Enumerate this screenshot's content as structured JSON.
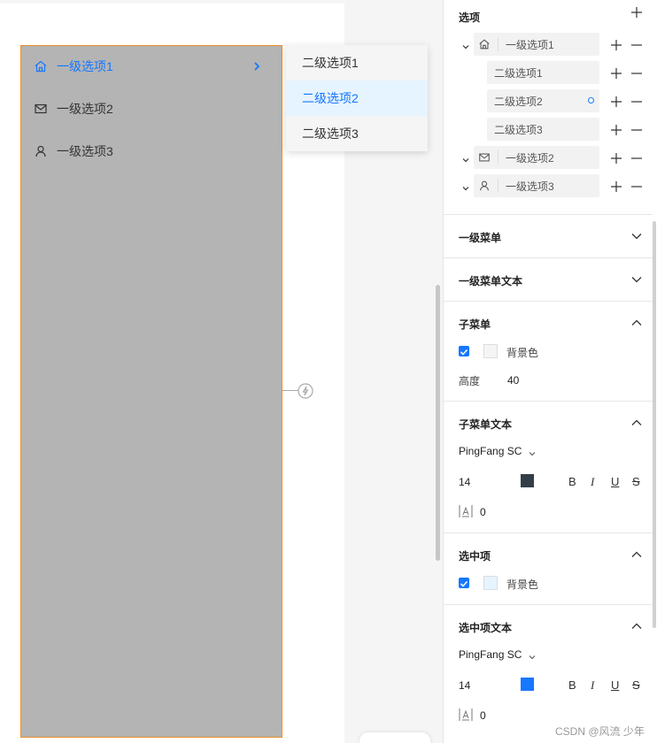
{
  "canvas": {
    "menu": {
      "items": [
        {
          "label": "一级选项1",
          "icon": "home-icon",
          "active": true
        },
        {
          "label": "一级选项2",
          "icon": "mail-icon",
          "active": false
        },
        {
          "label": "一级选项3",
          "icon": "user-icon",
          "active": false
        }
      ]
    },
    "submenu": {
      "items": [
        {
          "label": "二级选项1",
          "selected": false
        },
        {
          "label": "二级选项2",
          "selected": true
        },
        {
          "label": "二级选项3",
          "selected": false
        }
      ]
    }
  },
  "panel": {
    "options": {
      "title": "选项",
      "tree": [
        {
          "label": "一级选项1",
          "icon": "home-icon",
          "level": 1
        },
        {
          "label": "二级选项1",
          "level": 2
        },
        {
          "label": "二级选项2",
          "level": 2,
          "marked": true
        },
        {
          "label": "二级选项3",
          "level": 2
        },
        {
          "label": "一级选项2",
          "icon": "mail-icon",
          "level": 1
        },
        {
          "label": "一级选项3",
          "icon": "user-icon",
          "level": 1
        }
      ]
    },
    "sections": {
      "level1_menu": "一级菜单",
      "level1_text": "一级菜单文本",
      "submenu": "子菜单",
      "submenu_text": "子菜单文本",
      "selected": "选中项",
      "selected_text": "选中项文本"
    },
    "submenu": {
      "bg_label": "背景色",
      "bg_color": "#f5f5f5",
      "height_label": "高度",
      "height_value": "40"
    },
    "submenu_text": {
      "font": "PingFang SC",
      "size": "14",
      "color": "#333f48",
      "spacing": "0"
    },
    "selected": {
      "bg_label": "背景色",
      "bg_color": "#e6f4ff"
    },
    "selected_text": {
      "font": "PingFang SC",
      "size": "14",
      "color": "#1677ff",
      "spacing": "0"
    },
    "format": {
      "bold": "B",
      "italic": "I",
      "underline": "U",
      "strike": "S"
    }
  },
  "watermark": "CSDN @风流 少年"
}
